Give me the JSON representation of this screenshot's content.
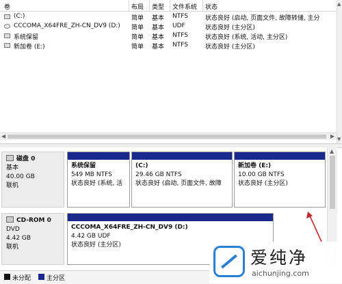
{
  "columns": [
    "卷",
    "布局",
    "类型",
    "文件系统",
    "状态"
  ],
  "volumes": [
    {
      "name": "(C:)",
      "layout": "简单",
      "type": "基本",
      "fs": "NTFS",
      "status": "状态良好 (启动, 页面文件, 故障转储, 主分"
    },
    {
      "name": "CCCOMA_X64FRE_ZH-CN_DV9 (D:)",
      "layout": "简单",
      "type": "基本",
      "fs": "UDF",
      "status": "状态良好 (主分区)"
    },
    {
      "name": "系统保留",
      "layout": "简单",
      "type": "基本",
      "fs": "NTFS",
      "status": "状态良好 (系统, 活动, 主分区)"
    },
    {
      "name": "新加卷 (E:)",
      "layout": "简单",
      "type": "基本",
      "fs": "NTFS",
      "status": "状态良好 (主分区)"
    }
  ],
  "disk0": {
    "name": "磁盘 0",
    "kind": "基本",
    "size": "40.00 GB",
    "state": "联机",
    "partitions": [
      {
        "title": "系统保留",
        "size": "549 MB NTFS",
        "status": "状态良好 (系统, 活"
      },
      {
        "title": "(C:)",
        "size": "29.46 GB NTFS",
        "status": "状态良好 (启动, 页面文件, 故障"
      },
      {
        "title": "新加卷 (E:)",
        "size": "10.00 GB NTFS",
        "status": "状态良好 (主分区)"
      }
    ]
  },
  "cdrom0": {
    "name": "CD-ROM 0",
    "kind": "DVD",
    "size": "4.42 GB",
    "state": "联机",
    "partition": {
      "title": "CCCOMA_X64FRE_ZH-CN_DV9 (D:)",
      "size": "4.42 GB UDF",
      "status": "状态良好 (主分区)"
    }
  },
  "legend": [
    {
      "label": "未分配",
      "color": "#111111"
    },
    {
      "label": "主分区",
      "color": "#1a2a8c"
    }
  ],
  "watermark": {
    "zh": "爱纯净",
    "en": "aichunjing.com"
  },
  "colors": {
    "primary_partition": "#1a2a8c",
    "arrow": "#c0272d"
  }
}
